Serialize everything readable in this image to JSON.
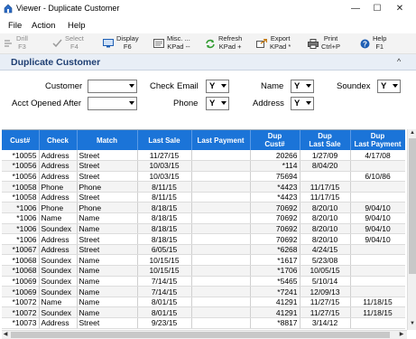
{
  "window": {
    "title": "Viewer - Duplicate Customer",
    "minimize_glyph": "—",
    "maximize_glyph": "☐",
    "close_glyph": "✕"
  },
  "menu": {
    "file": "File",
    "action": "Action",
    "help": "Help"
  },
  "toolbar": {
    "drill": {
      "line1": "Drill",
      "line2": "F3",
      "icon": "drill-icon"
    },
    "select": {
      "line1": "Select",
      "line2": "F4",
      "icon": "check-icon"
    },
    "display": {
      "line1": "Display",
      "line2": "F6",
      "icon": "display-icon"
    },
    "misc": {
      "line1": "Misc. ...",
      "line2": "KPad --",
      "icon": "misc-icon"
    },
    "refresh": {
      "line1": "Refresh",
      "line2": "KPad +",
      "icon": "refresh-icon"
    },
    "export": {
      "line1": "Export",
      "line2": "KPad *",
      "icon": "export-icon"
    },
    "print": {
      "line1": "Print",
      "line2": "Ctrl+P",
      "icon": "print-icon"
    },
    "help": {
      "line1": "Help",
      "line2": "F1",
      "icon": "help-icon"
    }
  },
  "section": {
    "title": "Duplicate Customer",
    "collapse_glyph": "^"
  },
  "form": {
    "customer_label": "Customer",
    "customer_value": "",
    "acct_opened_label": "Acct Opened After",
    "acct_opened_value": "",
    "check_label": "Check",
    "email_label": "Email",
    "email_value": "Y",
    "phone_label": "Phone",
    "phone_value": "Y",
    "name_label": "Name",
    "name_value": "Y",
    "address_label": "Address",
    "address_value": "Y",
    "soundex_label": "Soundex",
    "soundex_value": "Y"
  },
  "table": {
    "headers": {
      "cust": "Cust#",
      "check": "Check",
      "match": "Match",
      "last_sale": "Last Sale",
      "last_payment": "Last Payment",
      "dup_cust": "Dup\nCust#",
      "dup_last_sale": "Dup\nLast Sale",
      "dup_last_payment": "Dup\nLast Payment"
    },
    "rows": [
      [
        "*10055",
        "Address",
        "Street",
        "11/27/15",
        "",
        "20266",
        "1/27/09",
        "4/17/08"
      ],
      [
        "*10056",
        "Address",
        "Street",
        "10/03/15",
        "",
        "*114",
        "8/04/20",
        ""
      ],
      [
        "*10056",
        "Address",
        "Street",
        "10/03/15",
        "",
        "75694",
        "",
        "6/10/86"
      ],
      [
        "*10058",
        "Phone",
        "Phone",
        "8/11/15",
        "",
        "*4423",
        "11/17/15",
        ""
      ],
      [
        "*10058",
        "Address",
        "Street",
        "8/11/15",
        "",
        "*4423",
        "11/17/15",
        ""
      ],
      [
        "*1006",
        "Phone",
        "Phone",
        "8/18/15",
        "",
        "70692",
        "8/20/10",
        "9/04/10"
      ],
      [
        "*1006",
        "Name",
        "Name",
        "8/18/15",
        "",
        "70692",
        "8/20/10",
        "9/04/10"
      ],
      [
        "*1006",
        "Soundex",
        "Name",
        "8/18/15",
        "",
        "70692",
        "8/20/10",
        "9/04/10"
      ],
      [
        "*1006",
        "Address",
        "Street",
        "8/18/15",
        "",
        "70692",
        "8/20/10",
        "9/04/10"
      ],
      [
        "*10067",
        "Address",
        "Street",
        "6/05/15",
        "",
        "*6268",
        "4/24/15",
        ""
      ],
      [
        "*10068",
        "Soundex",
        "Name",
        "10/15/15",
        "",
        "*1617",
        "5/23/08",
        ""
      ],
      [
        "*10068",
        "Soundex",
        "Name",
        "10/15/15",
        "",
        "*1706",
        "10/05/15",
        ""
      ],
      [
        "*10069",
        "Soundex",
        "Name",
        "7/14/15",
        "",
        "*5465",
        "5/10/14",
        ""
      ],
      [
        "*10069",
        "Soundex",
        "Name",
        "7/14/15",
        "",
        "*7241",
        "12/09/13",
        ""
      ],
      [
        "*10072",
        "Name",
        "Name",
        "8/01/15",
        "",
        "41291",
        "11/27/15",
        "11/18/15"
      ],
      [
        "*10072",
        "Soundex",
        "Name",
        "8/01/15",
        "",
        "41291",
        "11/27/15",
        "11/18/15"
      ],
      [
        "*10073",
        "Address",
        "Street",
        "9/23/15",
        "",
        "*8817",
        "3/14/12",
        ""
      ]
    ]
  },
  "colors": {
    "header_bg": "#1b74d8",
    "section_title": "#1f3f73"
  }
}
